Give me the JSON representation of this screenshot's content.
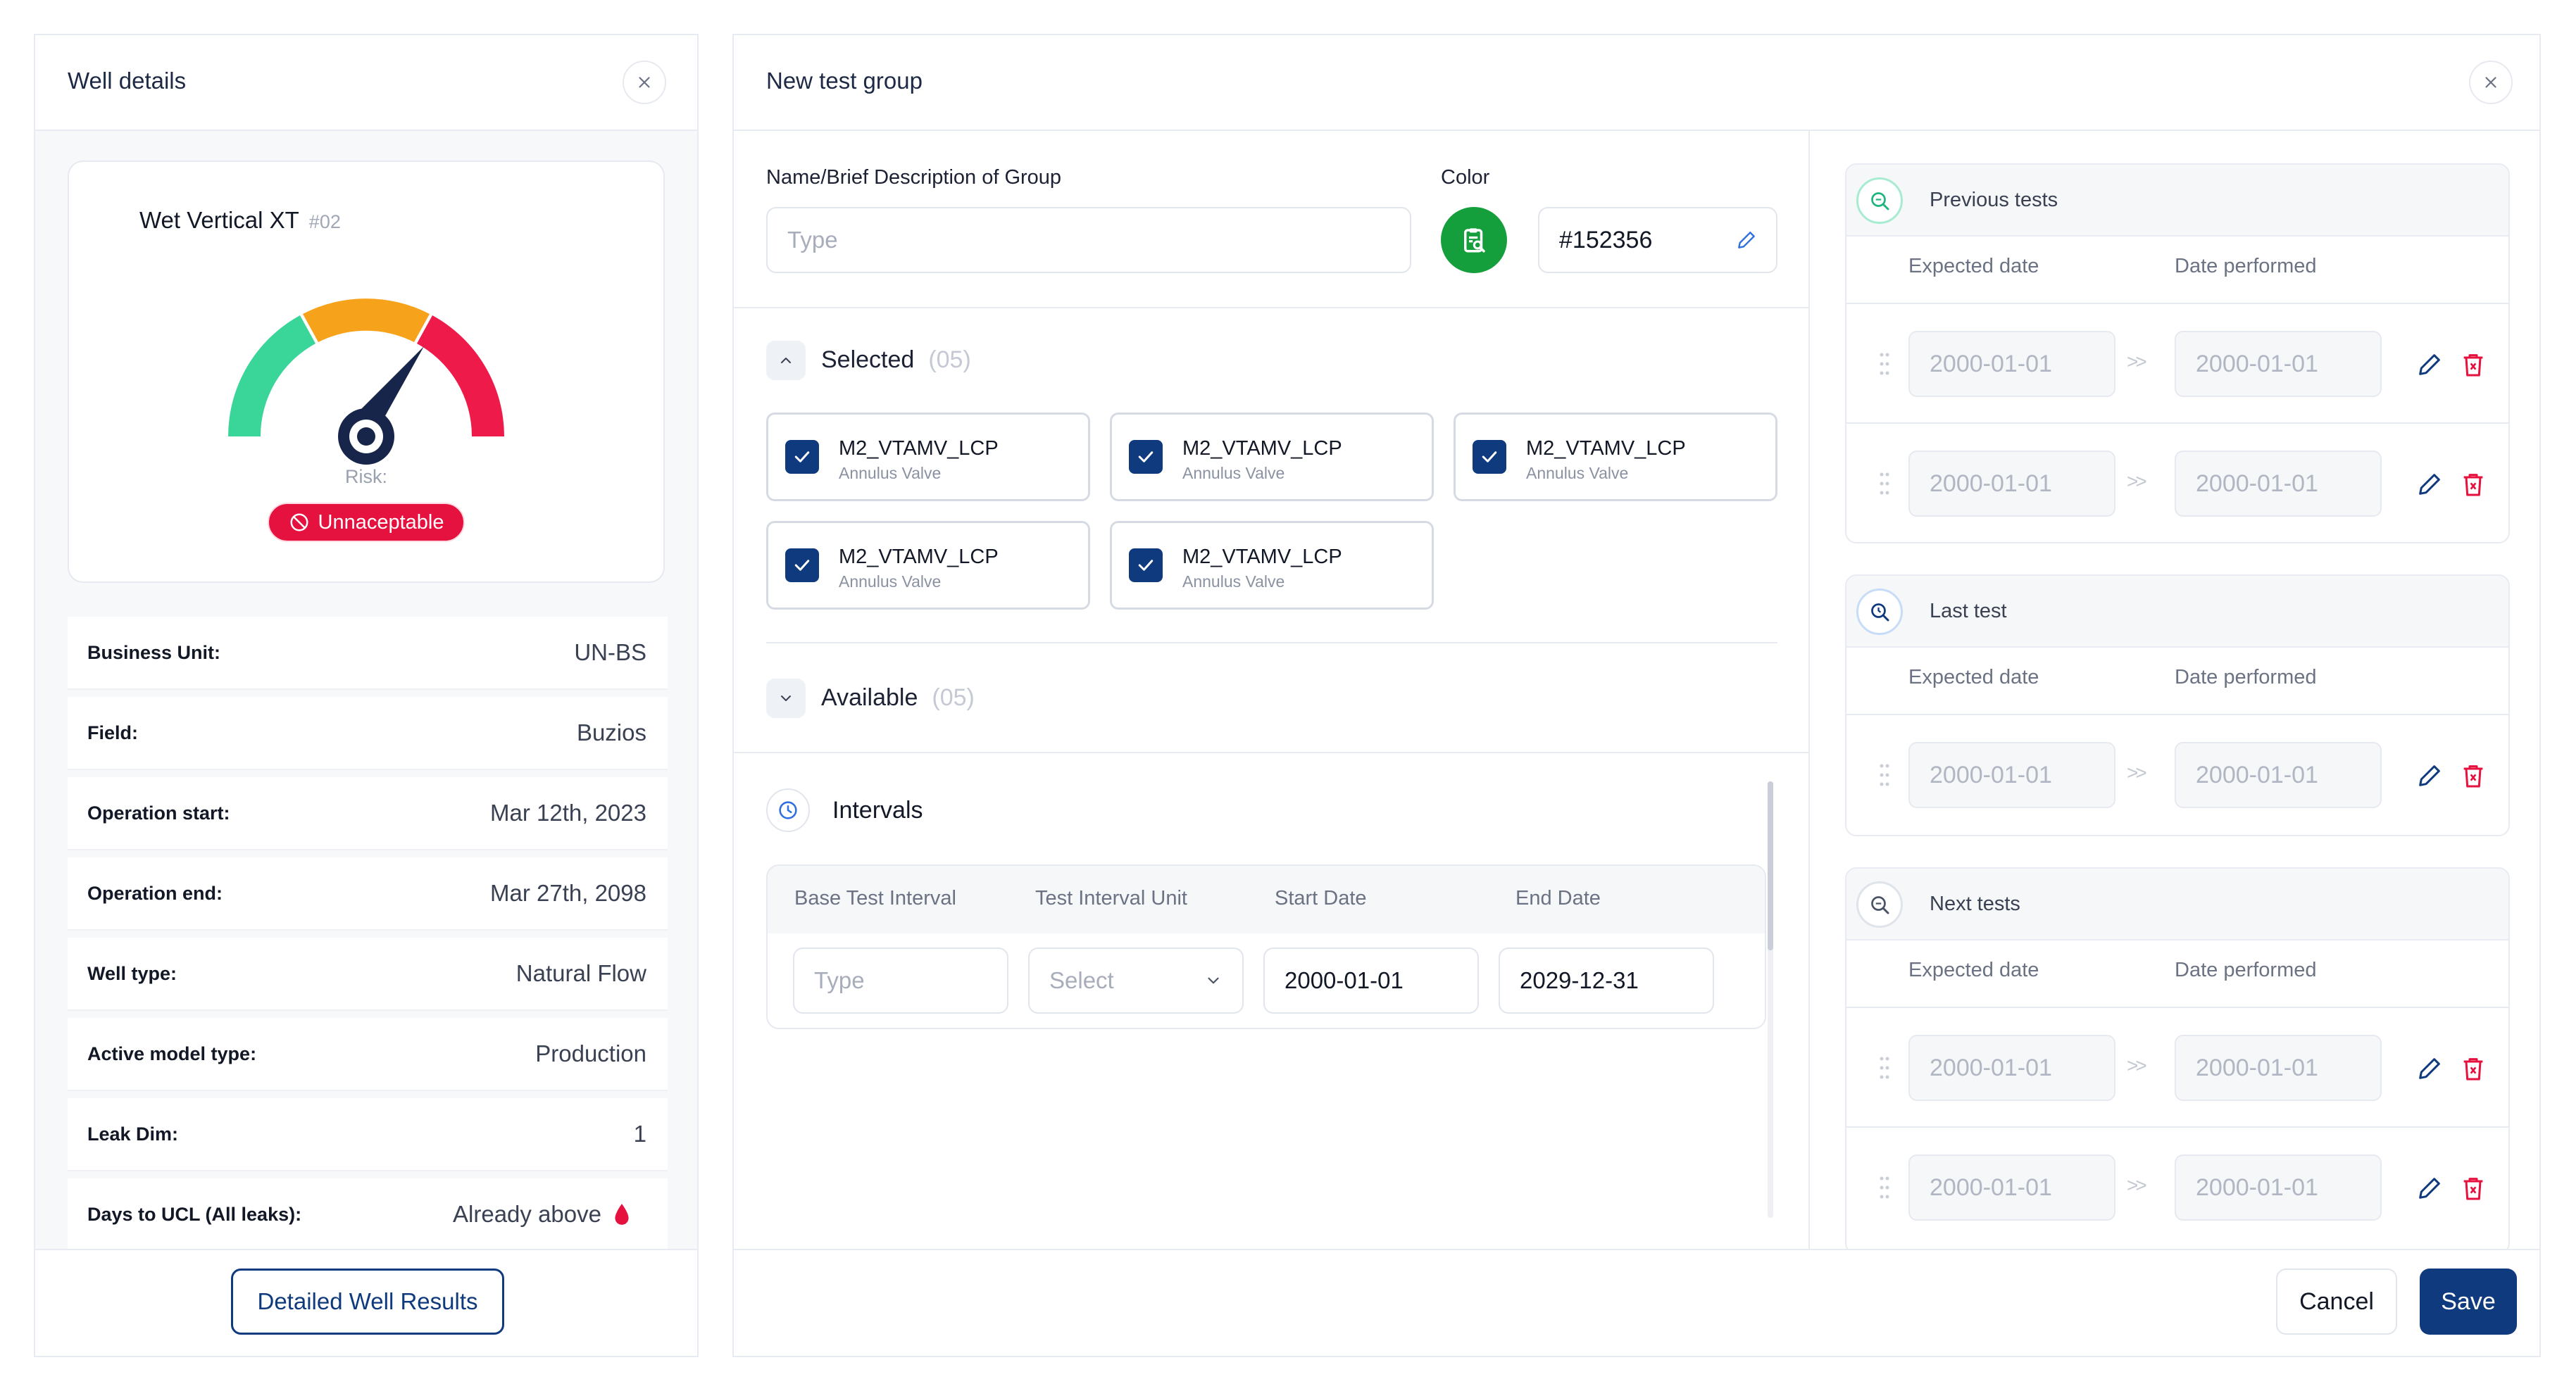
{
  "well_details": {
    "title": "Well details",
    "well_name": "Wet Vertical XT",
    "well_code": "#02",
    "risk_label": "Risk:",
    "risk_value": "Unnaceptable",
    "rows": [
      {
        "label": "Business Unit:",
        "value": "UN-BS"
      },
      {
        "label": "Field:",
        "value": "Buzios"
      },
      {
        "label": "Operation start:",
        "value": "Mar 12th, 2023"
      },
      {
        "label": "Operation end:",
        "value": "Mar 27th, 2098"
      },
      {
        "label": "Well type:",
        "value": "Natural Flow"
      },
      {
        "label": "Active model type:",
        "value": "Production"
      },
      {
        "label": "Leak Dim:",
        "value": "1"
      },
      {
        "label": "Days to UCL (All leaks):",
        "value": "Already above"
      }
    ],
    "detail_button": "Detailed Well Results"
  },
  "gauge": {
    "colors": {
      "low": "#3ad598",
      "medium": "#f7a21b",
      "high": "#ee1a4a",
      "needle": "#17254a"
    }
  },
  "new_group": {
    "title": "New test group",
    "name_label": "Name/Brief Description of Group",
    "name_placeholder": "Type",
    "color_label": "Color",
    "color_value": "#152356",
    "color_swatch": "#159e3c",
    "selected_label": "Selected",
    "selected_count": "(05)",
    "available_label": "Available",
    "available_count": "(05)",
    "valves": [
      {
        "name": "M2_VTAMV_LCP",
        "type": "Annulus Valve"
      },
      {
        "name": "M2_VTAMV_LCP",
        "type": "Annulus Valve"
      },
      {
        "name": "M2_VTAMV_LCP",
        "type": "Annulus Valve"
      },
      {
        "name": "M2_VTAMV_LCP",
        "type": "Annulus Valve"
      },
      {
        "name": "M2_VTAMV_LCP",
        "type": "Annulus Valve"
      }
    ],
    "intervals_title": "Intervals",
    "interval_columns": [
      "Base Test Interval",
      "Test Interval Unit",
      "Start Date",
      "End Date"
    ],
    "interval_row": {
      "base_placeholder": "Type",
      "unit_placeholder": "Select",
      "start_date": "2000-01-01",
      "end_date": "2029-12-31"
    },
    "cancel_label": "Cancel",
    "save_label": "Save"
  },
  "tests": {
    "expected_label": "Expected date",
    "performed_label": "Date performed",
    "previous_title": "Previous tests",
    "previous_rows": [
      {
        "expected": "2000-01-01",
        "performed": "2000-01-01"
      },
      {
        "expected": "2000-01-01",
        "performed": "2000-01-01"
      }
    ],
    "last_title": "Last test",
    "last_rows": [
      {
        "expected": "2000-01-01",
        "performed": "2000-01-01"
      }
    ],
    "next_title": "Next tests",
    "next_rows": [
      {
        "expected": "2000-01-01",
        "performed": "2000-01-01"
      },
      {
        "expected": "2000-01-01",
        "performed": "2000-01-01"
      }
    ],
    "arrow_glyph": ">>"
  }
}
